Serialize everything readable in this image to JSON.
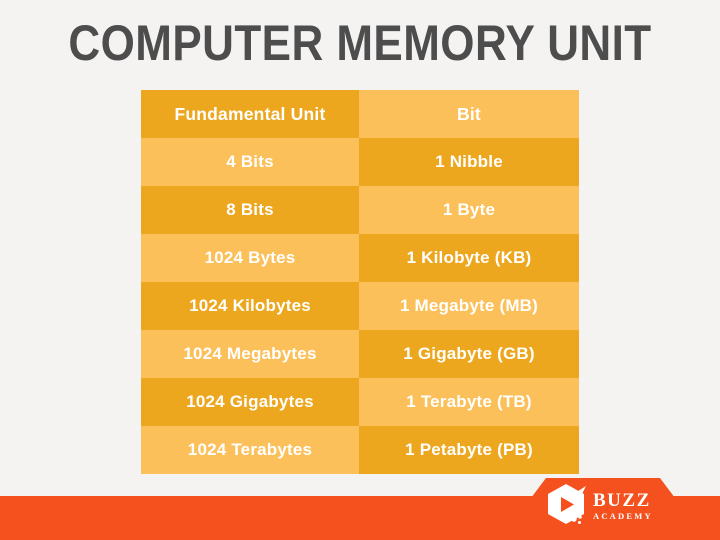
{
  "page": {
    "title": "COMPUTER MEMORY UNIT",
    "background_color": "#f4f3f2",
    "title_color": "#4d4d4d"
  },
  "table": {
    "shade_dark": "#eda71f",
    "shade_light": "#fbc05a",
    "text_color": "#ffffff",
    "header": {
      "left": "Fundamental Unit",
      "right": "Bit"
    },
    "rows": [
      {
        "left": "4 Bits",
        "right": "1 Nibble"
      },
      {
        "left": "8 Bits",
        "right": "1 Byte"
      },
      {
        "left": "1024 Bytes",
        "right": "1 Kilobyte (KB)"
      },
      {
        "left": "1024 Kilobytes",
        "right": "1 Megabyte (MB)"
      },
      {
        "left": "1024 Megabytes",
        "right": "1 Gigabyte (GB)"
      },
      {
        "left": "1024 Gigabytes",
        "right": "1 Terabyte (TB)"
      },
      {
        "left": "1024 Terabytes",
        "right": "1 Petabyte (PB)"
      }
    ]
  },
  "footer": {
    "bar_color": "#f4511e",
    "logo": {
      "mark_icon": "hexagon-play-icon",
      "name": "BUZZ",
      "tagline": "ACADEMY"
    }
  },
  "watermark": {
    "icon": "hexagon-play-watermark-icon"
  }
}
